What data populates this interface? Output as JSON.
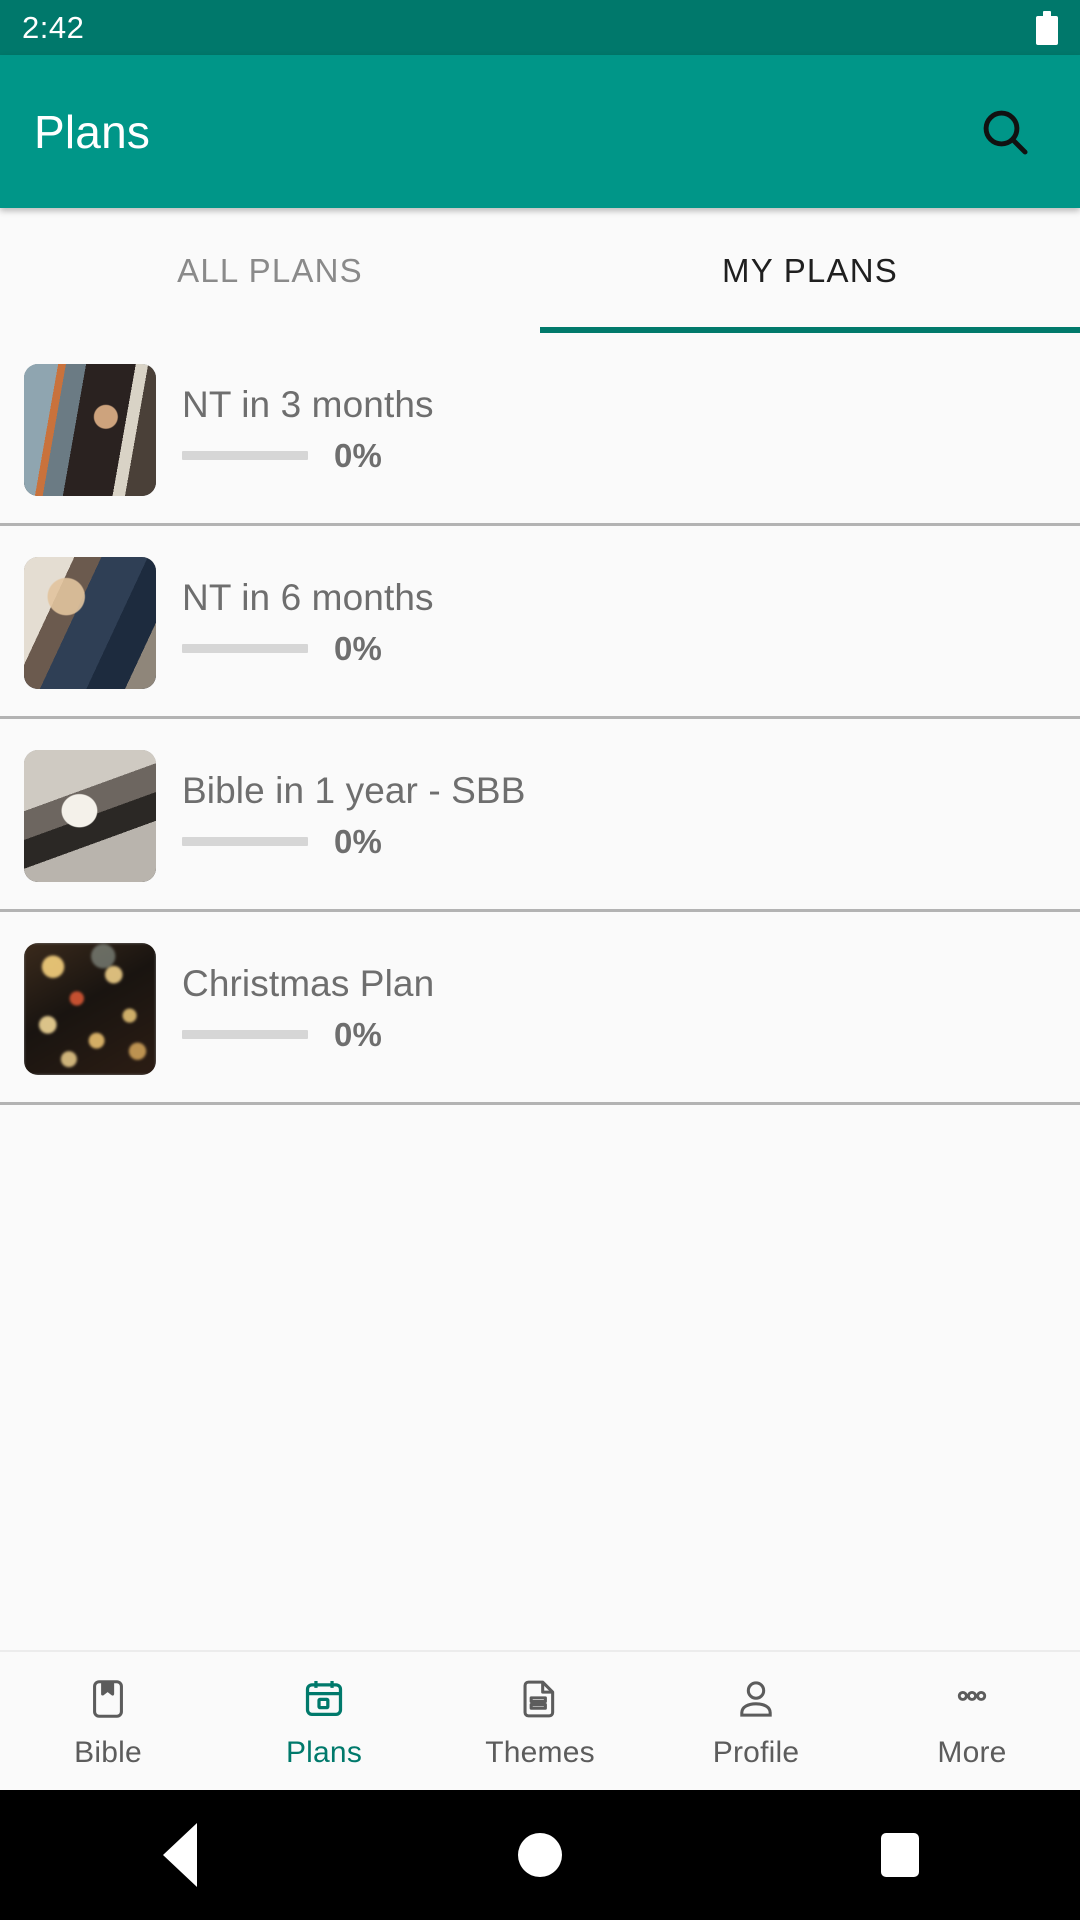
{
  "status_bar": {
    "clock": "2:42",
    "battery_icon": "battery-full-icon",
    "background_color": "#00786b"
  },
  "app_bar": {
    "title": "Plans",
    "search_icon": "search-icon",
    "background_color": "#009688",
    "title_color": "#ffffff"
  },
  "tabs": {
    "items": [
      {
        "label": "ALL PLANS",
        "active": false
      },
      {
        "label": "MY PLANS",
        "active": true
      }
    ],
    "indicator_color": "#00796b",
    "active_text_color": "#1f1f1f",
    "inactive_text_color": "#8a8a8a"
  },
  "plan_list": {
    "items": [
      {
        "title": "NT in 3 months",
        "progress_label": "0%",
        "progress_value": 0,
        "thumbnail": "person-reading-by-pool-photo"
      },
      {
        "title": "NT in 6 months",
        "progress_label": "0%",
        "progress_value": 0,
        "thumbnail": "woman-reading-by-water-photo"
      },
      {
        "title": "Bible in 1 year - SBB",
        "progress_label": "0%",
        "progress_value": 0,
        "thumbnail": "hands-holding-open-bible-photo"
      },
      {
        "title": "Christmas Plan",
        "progress_label": "0%",
        "progress_value": 0,
        "thumbnail": "christmas-lights-bokeh-photo"
      }
    ],
    "divider_color": "#b3b3b3",
    "track_color": "#d6d6d6",
    "text_color": "#6e6e6e"
  },
  "bottom_nav": {
    "items": [
      {
        "label": "Bible",
        "icon": "book-bookmark-icon",
        "active": false
      },
      {
        "label": "Plans",
        "icon": "calendar-icon",
        "active": true
      },
      {
        "label": "Themes",
        "icon": "document-lines-icon",
        "active": false
      },
      {
        "label": "Profile",
        "icon": "person-icon",
        "active": false
      },
      {
        "label": "More",
        "icon": "three-dots-icon",
        "active": false
      }
    ],
    "active_color": "#00796b",
    "inactive_color": "#5c5c5c"
  },
  "android_nav": {
    "back": "back-triangle-icon",
    "home": "home-circle-icon",
    "recents": "recents-square-icon"
  }
}
